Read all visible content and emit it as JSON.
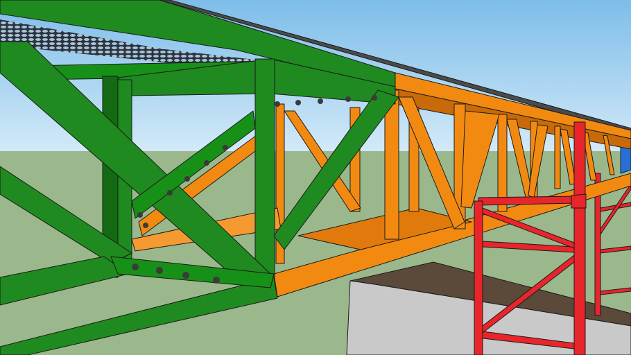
{
  "scene": {
    "subject": "truss-bridge-3d-model",
    "colors": {
      "sky_top": "#7dbde9",
      "sky_horizon": "#d3eaf8",
      "ground": "#9ab88c",
      "green_truss": "#1f8a1f",
      "green_truss_dark": "#136a13",
      "orange_truss": "#f28a12",
      "orange_truss_dark": "#c86a08",
      "red_tower": "#e8252a",
      "blue_truss": "#2a6fd6",
      "concrete_front": "#c9c9c9",
      "concrete_top": "#5b4a39",
      "grating": "#6b7d8c",
      "bolt": "#3a3a3a"
    }
  }
}
